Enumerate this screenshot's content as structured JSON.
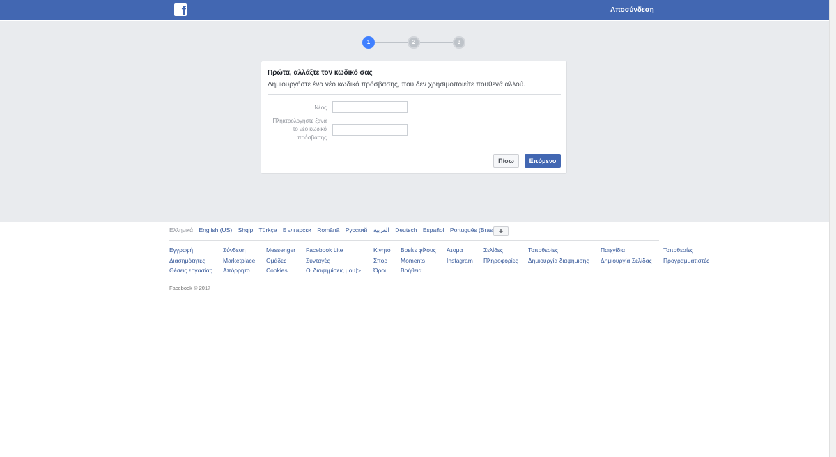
{
  "header": {
    "logo": "f",
    "logout_label": "Αποσύνδεση"
  },
  "stepper": {
    "steps": [
      "1",
      "2",
      "3"
    ],
    "active_step": 1
  },
  "card": {
    "title": "Πρώτα, αλλάξτε τον κωδικό σας",
    "subtitle": "Δημιουργήστε ένα νέο κωδικό πρόσβασης, που δεν χρησιμοποιείτε πουθενά αλλού.",
    "new_password_label": "Νέος",
    "new_password_value": "",
    "confirm_label_line1": "Πληκτρολογήστε ξανά",
    "confirm_label_line2": "το νέο κωδικό",
    "confirm_label_line3": "πρόσβασης",
    "confirm_value": "",
    "back_label": "Πίσω",
    "next_label": "Επόμενο"
  },
  "footer": {
    "languages": [
      "Ελληνικά",
      "English (US)",
      "Shqip",
      "Türkçe",
      "Български",
      "Română",
      "Русский",
      "العربية",
      "Deutsch",
      "Español",
      "Português (Brasil)"
    ],
    "more_languages_label": "+",
    "columns": [
      [
        "Εγγραφή",
        "Διασημότητες",
        "Θέσεις εργασίας"
      ],
      [
        "Σύνδεση",
        "Marketplace",
        "Απόρρητο"
      ],
      [
        "Messenger",
        "Ομάδες",
        "Cookies"
      ],
      [
        "Facebook Lite",
        "Συνταγές",
        "Οι διαφημίσεις μου"
      ],
      [
        "Κινητό",
        "Σπορ",
        "Όροι"
      ],
      [
        "Βρείτε φίλους",
        "Moments",
        "Βοήθεια"
      ],
      [
        "Άτομα",
        "Instagram"
      ],
      [
        "Σελίδες",
        "Πληροφορίες"
      ],
      [
        "Τοποθεσίες",
        "Δημιουργία διαφήμισης"
      ],
      [
        "Παιχνίδια",
        "Δημιουργία Σελίδας"
      ],
      [
        "Τοποθεσίες",
        "Προγραμματιστές"
      ]
    ],
    "adchoices_icon": "adchoices-icon",
    "copyright": "Facebook © 2017"
  },
  "colors": {
    "brand": "#4267b2",
    "background": "#e9ebee",
    "link": "#365899",
    "step_active": "#4080ff",
    "step_inactive": "#bec3c9"
  }
}
